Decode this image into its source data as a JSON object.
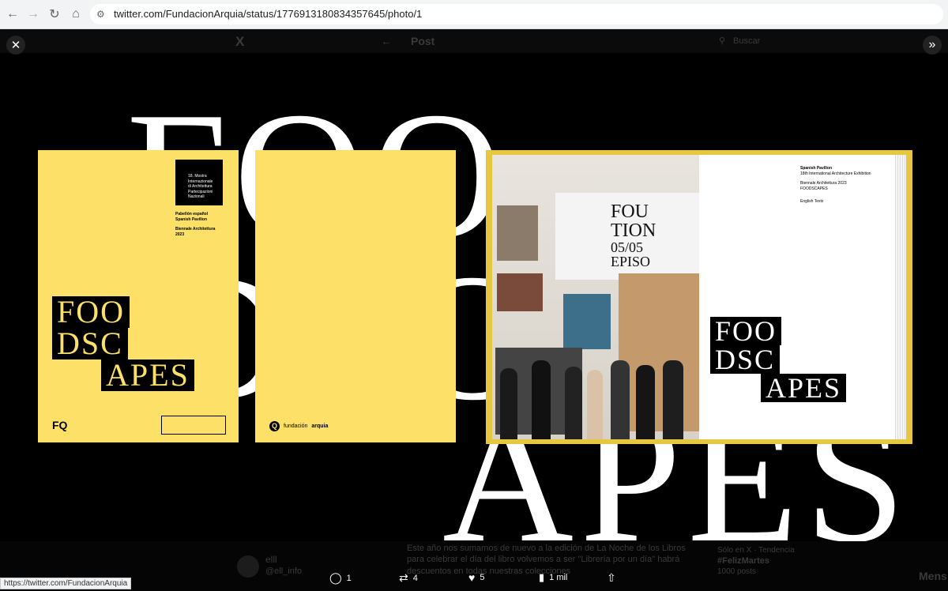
{
  "browser": {
    "url": "twitter.com/FundacionArquia/status/1776913180834357645/photo/1",
    "status_url": "https://twitter.com/FundacionArquia"
  },
  "background_ui": {
    "logo": "X",
    "post_title": "Post",
    "search_placeholder": "Buscar",
    "user_name": "elll",
    "user_handle": "@ell_info",
    "tweet_text": "Este año nos sumamos de nuevo a la edición de La Noche de los Libros para celebrar el día del libro volvemos a ser \"Librería por un día\" habrá descuentos en todas nuestras colecciones",
    "trend_meta": "Sólo en X · Tendencia",
    "trend_tag": "#FelizMartes",
    "trend_posts": "1000 posts",
    "more_text": "Mens"
  },
  "artwork": {
    "background_text": [
      "FOO",
      "DSC",
      "APES"
    ],
    "cover": {
      "header_lines": [
        "18. Mostra",
        "Internazionale",
        "di Architettura",
        "Partecipazioni Nazionali"
      ],
      "pavilion_es": "Pabellón español",
      "pavilion_en": "Spanish Pavilion",
      "biennale": "Biennale Architettura",
      "year": "2023",
      "title_rows": [
        "FOO",
        "DSC",
        "APES"
      ],
      "logo": "FQ"
    },
    "back_cover": {
      "logo_letter": "Q",
      "brand_light": "fundación",
      "brand_bold": "arquia"
    },
    "book": {
      "photo_text_lines": [
        "FOU",
        "TION",
        "05/05",
        "EPISO"
      ],
      "right_page_lines": [
        "Spanish Pavilion",
        "18th International Architecture Exhibition",
        "Biennale Architettura 2023",
        "FOODSCAPES",
        "English Texts"
      ],
      "title_rows": [
        "FOO",
        "DSC",
        "APES"
      ]
    }
  },
  "actions": {
    "replies": "1",
    "reposts": "4",
    "likes": "5",
    "views": "1 mil"
  },
  "colors": {
    "accent_yellow": "#fde068",
    "background": "#000000"
  }
}
